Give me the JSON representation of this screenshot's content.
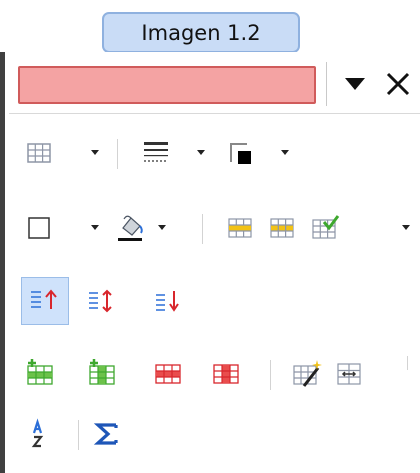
{
  "caption": {
    "text": "Imagen 1.2"
  },
  "titlebar": {
    "name_field_color": "#f4a3a3"
  },
  "toolbar": {
    "rows": [
      [
        "table",
        "borders",
        "border-style",
        "border-color"
      ],
      [
        "borders-box",
        "fill-color",
        "merge-cells",
        "split-cells",
        "autoformat"
      ],
      [
        "align-top",
        "align-center",
        "align-bottom"
      ],
      [
        "insert-row",
        "insert-column",
        "delete-row",
        "delete-column",
        "select-table",
        "optimize"
      ],
      [
        "sort",
        "sum"
      ]
    ],
    "active_button": "align-top",
    "colors": {
      "accent_blue": "#2c6fd8",
      "green": "#3ea82e",
      "red": "#d8262c",
      "yellow": "#f2c215"
    }
  }
}
